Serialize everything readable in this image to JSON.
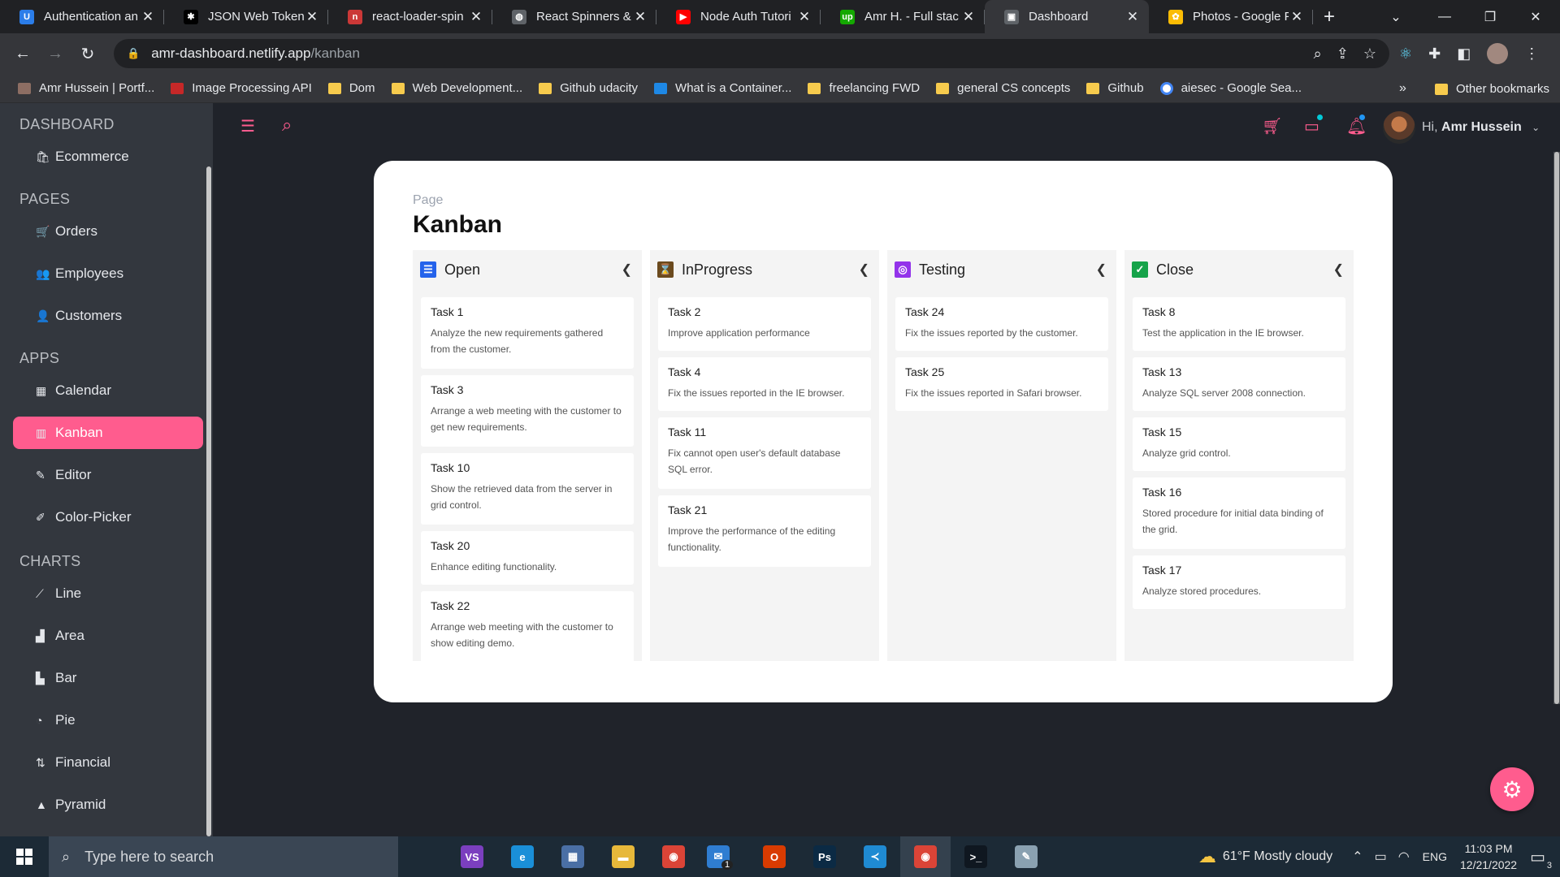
{
  "browser": {
    "tabs": [
      {
        "label": "Authentication an",
        "icon": "u-icon",
        "color": "#2b7de9",
        "glyph": "U"
      },
      {
        "label": "JSON Web Tokens",
        "icon": "jwt-icon",
        "color": "#000000",
        "glyph": "✱"
      },
      {
        "label": "react-loader-spin",
        "icon": "npm-icon",
        "color": "#cb3837",
        "glyph": "n"
      },
      {
        "label": "React Spinners &",
        "icon": "globe-icon",
        "color": "#5f6368",
        "glyph": "◍"
      },
      {
        "label": "Node Auth Tutori",
        "icon": "youtube-icon",
        "color": "#ff0000",
        "glyph": "▶"
      },
      {
        "label": "Amr H. - Full stac",
        "icon": "upwork-icon",
        "color": "#14a800",
        "glyph": "up"
      },
      {
        "label": "Dashboard",
        "icon": "dashboard-icon",
        "color": "#5f6368",
        "glyph": "▣",
        "active": true
      },
      {
        "label": "Photos - Google F",
        "icon": "google-photos-icon",
        "color": "#fbbc04",
        "glyph": "✿"
      }
    ],
    "url_host": "amr-dashboard.netlify.app",
    "url_path": "/kanban",
    "bookmarks": [
      {
        "label": "Amr Hussein | Portf...",
        "type": "site",
        "color": "#8d6e63"
      },
      {
        "label": "Image Processing API",
        "type": "site",
        "color": "#c62828"
      },
      {
        "label": "Dom",
        "type": "folder"
      },
      {
        "label": "Web Development...",
        "type": "folder"
      },
      {
        "label": "Github udacity",
        "type": "folder"
      },
      {
        "label": "What is a Container...",
        "type": "site",
        "color": "#1e88e5"
      },
      {
        "label": "freelancing FWD",
        "type": "folder"
      },
      {
        "label": "general CS concepts",
        "type": "folder"
      },
      {
        "label": "Github",
        "type": "folder"
      },
      {
        "label": "aiesec - Google Sea...",
        "type": "google"
      }
    ],
    "overflow": "»",
    "other_bookmarks": "Other bookmarks"
  },
  "sidebar": {
    "sections": [
      {
        "title": "DASHBOARD",
        "items": [
          {
            "label": "Ecommerce",
            "icon": "bag-icon",
            "glyph": "🛍"
          }
        ]
      },
      {
        "title": "PAGES",
        "items": [
          {
            "label": "Orders",
            "icon": "cart-icon",
            "glyph": "🛒"
          },
          {
            "label": "Employees",
            "icon": "employees-icon",
            "glyph": "👥"
          },
          {
            "label": "Customers",
            "icon": "customers-icon",
            "glyph": "👤"
          }
        ]
      },
      {
        "title": "APPS",
        "items": [
          {
            "label": "Calendar",
            "icon": "calendar-icon",
            "glyph": "▦"
          },
          {
            "label": "Kanban",
            "icon": "kanban-icon",
            "glyph": "▥",
            "active": true
          },
          {
            "label": "Editor",
            "icon": "editor-icon",
            "glyph": "✎"
          },
          {
            "label": "Color-Picker",
            "icon": "color-picker-icon",
            "glyph": "✐"
          }
        ]
      },
      {
        "title": "CHARTS",
        "items": [
          {
            "label": "Line",
            "icon": "line-chart-icon",
            "glyph": "⟋"
          },
          {
            "label": "Area",
            "icon": "area-chart-icon",
            "glyph": "▟"
          },
          {
            "label": "Bar",
            "icon": "bar-chart-icon",
            "glyph": "▙"
          },
          {
            "label": "Pie",
            "icon": "pie-chart-icon",
            "glyph": "◔"
          },
          {
            "label": "Financial",
            "icon": "financial-icon",
            "glyph": "⇅"
          },
          {
            "label": "Pyramid",
            "icon": "pyramid-icon",
            "glyph": "▲"
          }
        ]
      }
    ]
  },
  "header": {
    "greeting": "Hi,",
    "user_name": "Amr Hussein",
    "accent": "#ff5c8e"
  },
  "page": {
    "breadcrumb": "Page",
    "title": "Kanban"
  },
  "kanban": {
    "columns": [
      {
        "label": "Open",
        "icon": "open-icon",
        "color": "#2563eb",
        "glyph": "☰",
        "cards": [
          {
            "title": "Task 1",
            "desc": "Analyze the new requirements gathered from the customer."
          },
          {
            "title": "Task 3",
            "desc": "Arrange a web meeting with the customer to get new requirements."
          },
          {
            "title": "Task 10",
            "desc": "Show the retrieved data from the server in grid control."
          },
          {
            "title": "Task 20",
            "desc": "Enhance editing functionality."
          },
          {
            "title": "Task 22",
            "desc": "Arrange web meeting with the customer to show editing demo."
          }
        ]
      },
      {
        "label": "InProgress",
        "icon": "hourglass-icon",
        "color": "#6b4a1e",
        "glyph": "⌛",
        "cards": [
          {
            "title": "Task 2",
            "desc": "Improve application performance"
          },
          {
            "title": "Task 4",
            "desc": "Fix the issues reported in the IE browser."
          },
          {
            "title": "Task 11",
            "desc": "Fix cannot open user's default database SQL error."
          },
          {
            "title": "Task 21",
            "desc": "Improve the performance of the editing functionality."
          }
        ]
      },
      {
        "label": "Testing",
        "icon": "testing-icon",
        "color": "#9333ea",
        "glyph": "◎",
        "cards": [
          {
            "title": "Task 24",
            "desc": "Fix the issues reported by the customer."
          },
          {
            "title": "Task 25",
            "desc": "Fix the issues reported in Safari browser."
          }
        ]
      },
      {
        "label": "Close",
        "icon": "check-icon",
        "color": "#16a34a",
        "glyph": "✓",
        "cards": [
          {
            "title": "Task 8",
            "desc": "Test the application in the IE browser."
          },
          {
            "title": "Task 13",
            "desc": "Analyze SQL server 2008 connection."
          },
          {
            "title": "Task 15",
            "desc": "Analyze grid control."
          },
          {
            "title": "Task 16",
            "desc": "Stored procedure for initial data binding of the grid."
          },
          {
            "title": "Task 17",
            "desc": "Analyze stored procedures."
          }
        ]
      }
    ]
  },
  "taskbar": {
    "search_placeholder": "Type here to search",
    "apps": [
      {
        "name": "visual-studio-icon",
        "color": "#7b3fbf",
        "glyph": "VS"
      },
      {
        "name": "edge-icon",
        "color": "#1a8fd8",
        "glyph": "e"
      },
      {
        "name": "store-icon",
        "color": "#4a6fa5",
        "glyph": "▦"
      },
      {
        "name": "file-explorer-icon",
        "color": "#e7b83a",
        "glyph": "▬"
      },
      {
        "name": "chrome-icon",
        "color": "#db4437",
        "glyph": "◉"
      },
      {
        "name": "mail-icon",
        "color": "#2f7dd1",
        "glyph": "✉",
        "badge": "1"
      },
      {
        "name": "office-icon",
        "color": "#d83b01",
        "glyph": "O"
      },
      {
        "name": "photoshop-icon",
        "color": "#0b2a44",
        "glyph": "Ps"
      },
      {
        "name": "vscode-icon",
        "color": "#1f8ad2",
        "glyph": "≺"
      },
      {
        "name": "chrome-active-icon",
        "color": "#db4437",
        "glyph": "◉",
        "running": true
      },
      {
        "name": "terminal-icon",
        "color": "#0f1720",
        "glyph": ">_"
      },
      {
        "name": "paint-icon",
        "color": "#8aa1b1",
        "glyph": "✎"
      }
    ],
    "weather": "61°F  Mostly cloudy",
    "language": "ENG",
    "time": "11:03 PM",
    "date": "12/21/2022",
    "notif_count": "3"
  }
}
